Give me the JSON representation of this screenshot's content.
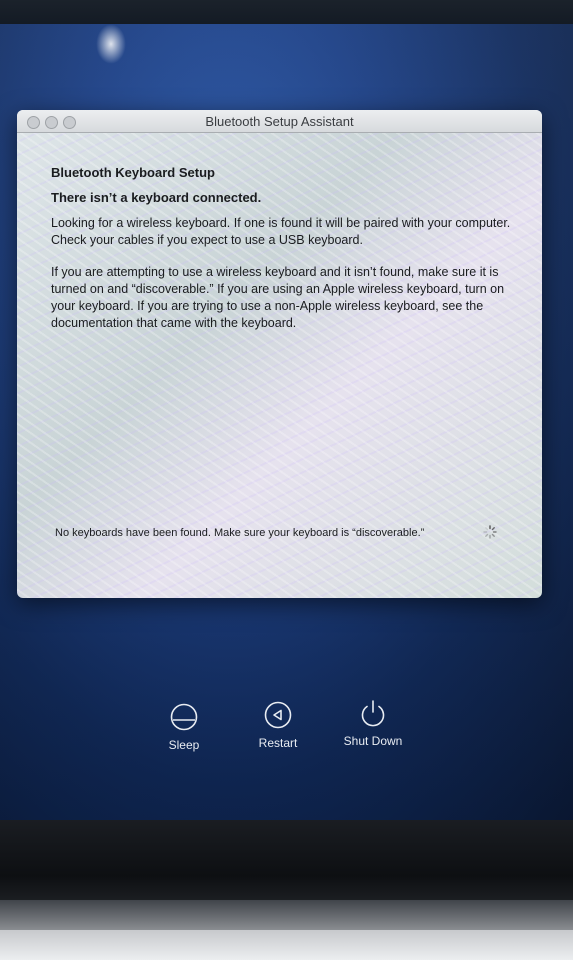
{
  "window": {
    "title": "Bluetooth Setup Assistant"
  },
  "dialog": {
    "heading": "Bluetooth Keyboard Setup",
    "subheading": "There isn’t a keyboard connected.",
    "paragraph1": "Looking for a wireless keyboard. If one is found it will be paired with your computer. Check your cables if you expect to use a USB keyboard.",
    "paragraph2": "If you are attempting to use a wireless keyboard and it isn’t found, make sure it is turned on and “discoverable.” If you are using an Apple wireless keyboard, turn on your keyboard. If you are trying to use a non-Apple wireless keyboard, see the documentation that came with the keyboard.",
    "status": "No keyboards have been found. Make sure your keyboard is “discoverable.”"
  },
  "power_buttons": {
    "sleep": "Sleep",
    "restart": "Restart",
    "shutdown": "Shut Down"
  },
  "icons": {
    "sleep": "sleep-icon",
    "restart": "restart-icon",
    "shutdown": "power-icon",
    "spinner": "loading-spinner-icon"
  }
}
